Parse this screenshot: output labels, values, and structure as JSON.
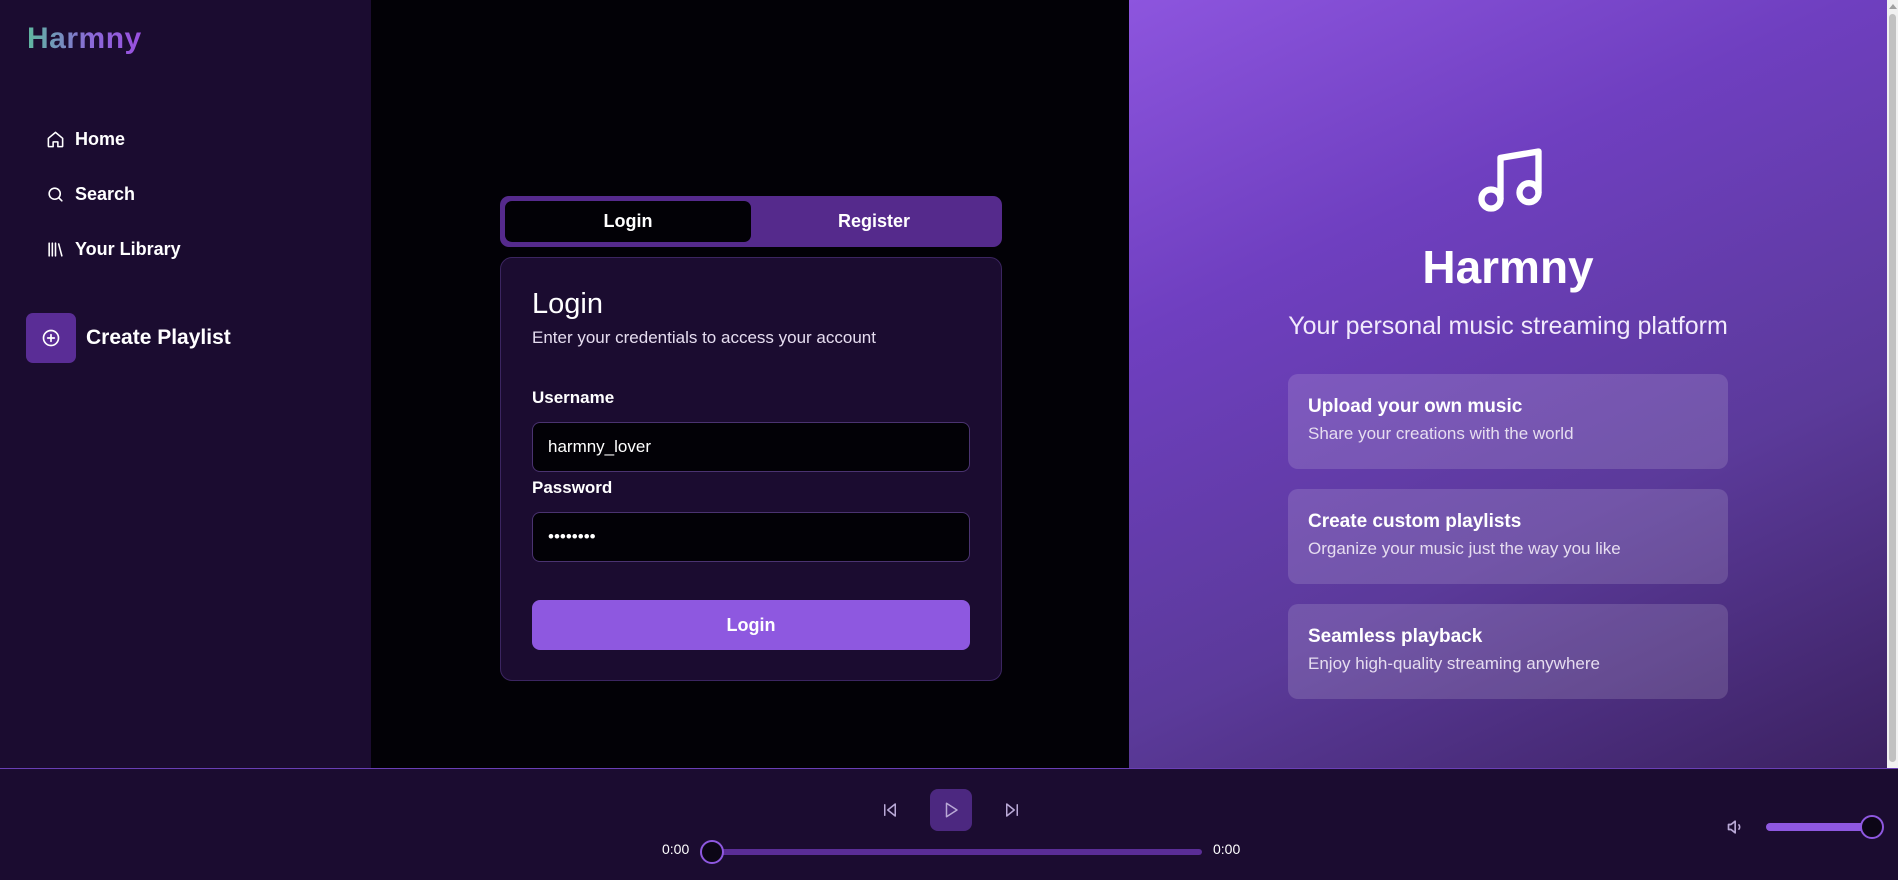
{
  "app": {
    "name": "Harmny"
  },
  "sidebar": {
    "items": [
      {
        "label": "Home",
        "icon": "home-icon"
      },
      {
        "label": "Search",
        "icon": "search-icon"
      },
      {
        "label": "Your Library",
        "icon": "library-icon"
      }
    ],
    "create_playlist": {
      "label": "Create Playlist",
      "icon": "plus-circle-icon"
    }
  },
  "auth": {
    "tabs": [
      {
        "label": "Login",
        "active": true
      },
      {
        "label": "Register",
        "active": false
      }
    ],
    "title": "Login",
    "subtitle": "Enter your credentials to access your account",
    "username": {
      "label": "Username",
      "value": "harmny_lover"
    },
    "password": {
      "label": "Password",
      "value": "password"
    },
    "submit_label": "Login"
  },
  "hero": {
    "icon": "music-note-icon",
    "title": "Harmny",
    "subtitle": "Your personal music streaming platform",
    "features": [
      {
        "title": "Upload your own music",
        "desc": "Share your creations with the world"
      },
      {
        "title": "Create custom playlists",
        "desc": "Organize your music just the way you like"
      },
      {
        "title": "Seamless playback",
        "desc": "Enjoy high-quality streaming anywhere"
      }
    ]
  },
  "player": {
    "current_time": "0:00",
    "duration": "0:00",
    "progress_fraction": 0,
    "volume_fraction": 1
  },
  "colors": {
    "accent": "#8e58e0",
    "sidebar_bg": "#1b0c30",
    "main_bg": "#020106"
  }
}
